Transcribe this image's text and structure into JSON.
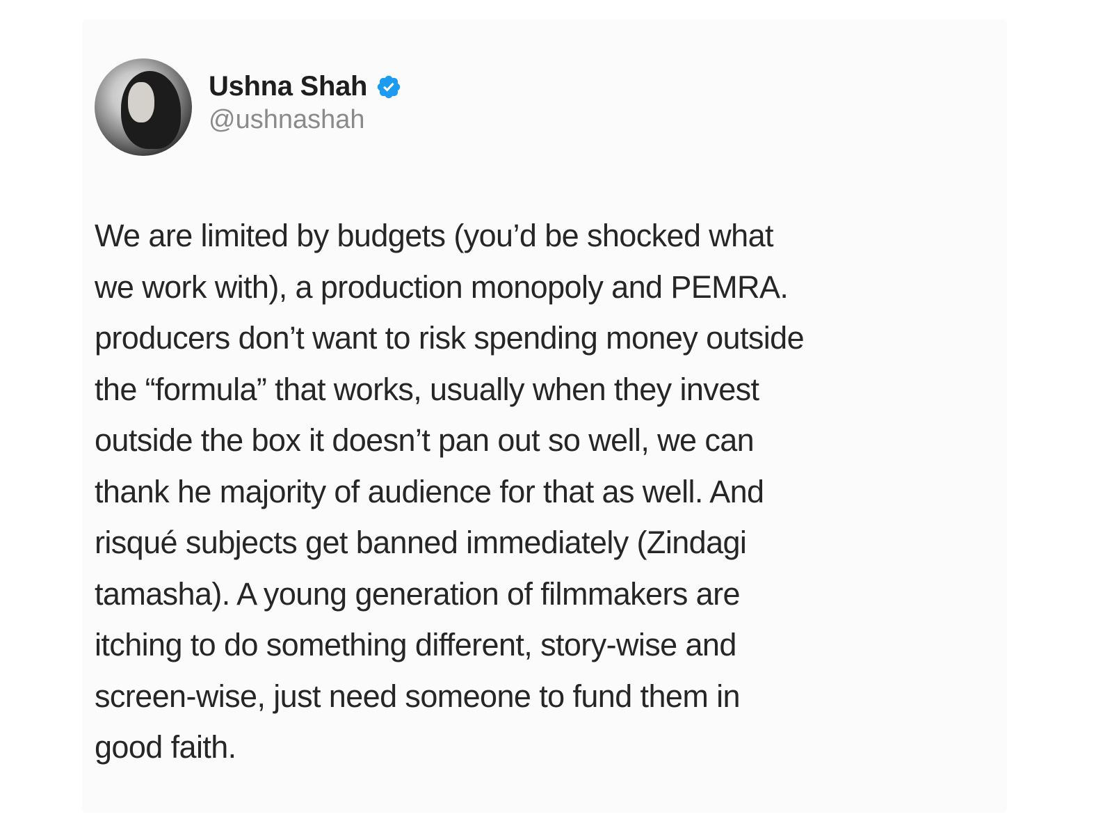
{
  "tweet": {
    "author": {
      "name": "Ushna Shah",
      "handle": "@ushnashah",
      "verified": true,
      "verified_color": "#1d9bf0",
      "avatar": "profile-photo"
    },
    "body_lines": [
      "We are limited by budgets (you’d be shocked what",
      "we work with), a production monopoly and PEMRA.",
      "producers don’t want to risk spending money outside",
      "the “formula” that works, usually when they invest",
      "outside the box it doesn’t pan out so well, we can",
      "thank he majority of audience for that as well. And",
      "risqué subjects get banned immediately (Zindagi",
      "tamasha). A young generation of filmmakers are",
      "itching to do something different, story-wise and",
      "screen-wise, just need someone to fund them in",
      "good faith."
    ]
  }
}
